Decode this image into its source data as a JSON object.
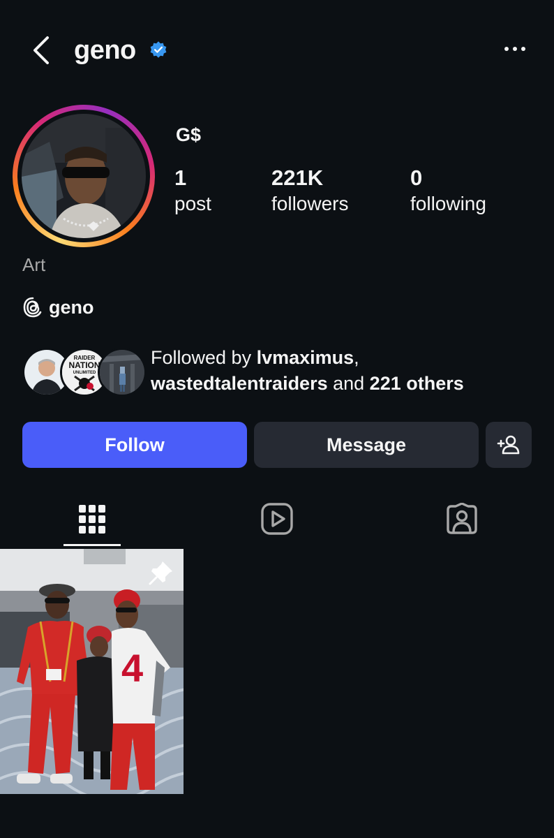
{
  "header": {
    "username": "geno",
    "verified": true,
    "back_icon": "chevron-left-icon",
    "more_icon": "more-horizontal-icon"
  },
  "profile": {
    "full_name": "G$",
    "category": "Art",
    "threads_handle": "geno",
    "stats": {
      "posts_count": "1",
      "posts_label": "post",
      "followers_count": "221K",
      "followers_label": "followers",
      "following_count": "0",
      "following_label": "following"
    }
  },
  "followed_by": {
    "prefix": "Followed by ",
    "user1": "lvmaximus",
    "separator": ",",
    "user2": "wastedtalentraiders",
    "middle": " and ",
    "others": "221 others",
    "mutual_badge_lines": [
      "RAIDER",
      "NATION",
      "UNLIMITED"
    ]
  },
  "actions": {
    "follow_label": "Follow",
    "message_label": "Message",
    "add_user_icon": "add-person-icon"
  },
  "tabs": [
    {
      "name": "posts-grid",
      "icon": "grid-icon",
      "active": true
    },
    {
      "name": "reels",
      "icon": "reels-icon",
      "active": false
    },
    {
      "name": "tagged",
      "icon": "tagged-person-icon",
      "active": false
    }
  ],
  "posts": [
    {
      "pinned": true,
      "jersey_text": "4"
    }
  ],
  "colors": {
    "background": "#0c1014",
    "primary": "#4a5df9",
    "secondary_button": "#262a33",
    "verified_badge": "#3897f0"
  }
}
